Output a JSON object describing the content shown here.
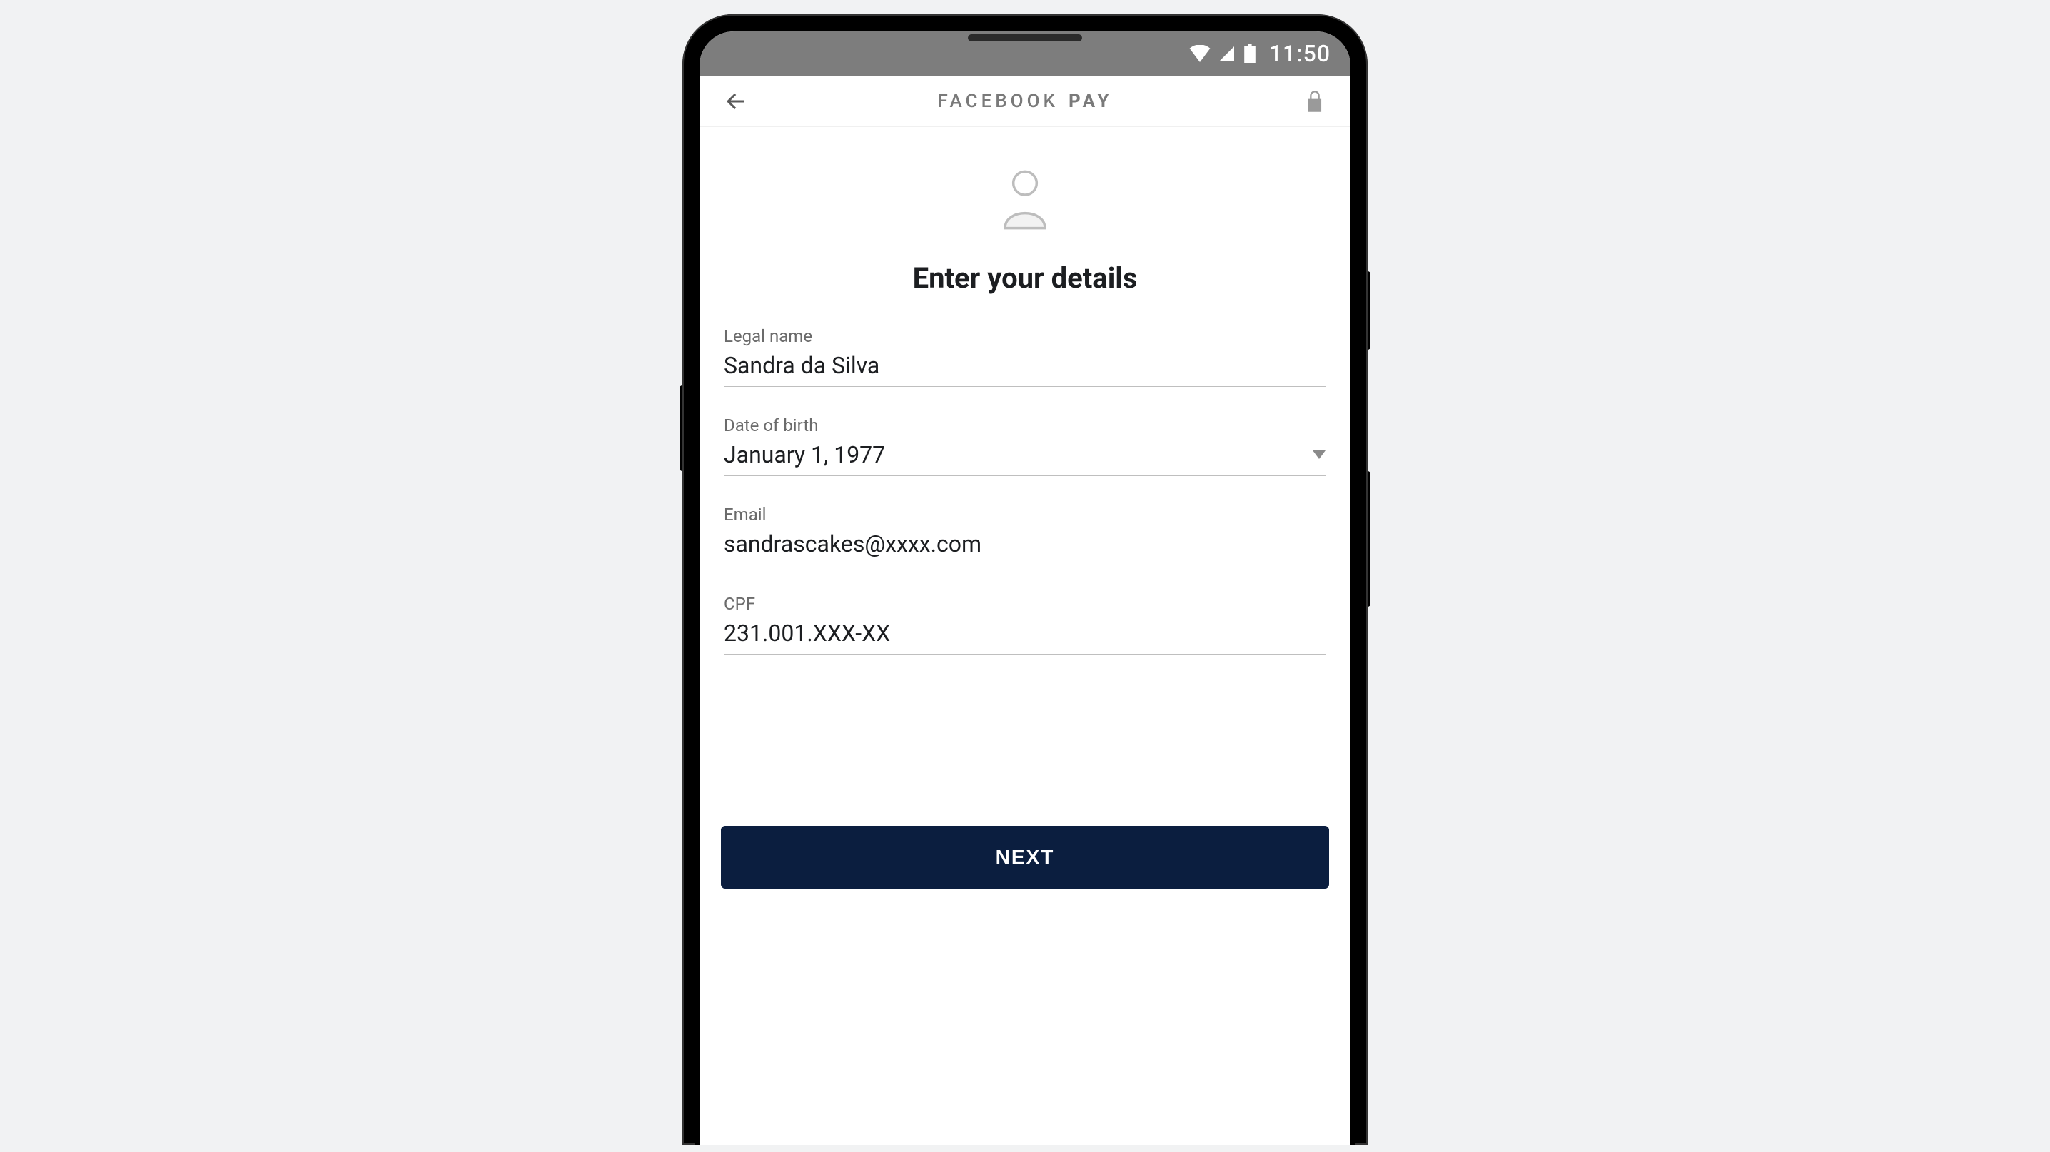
{
  "status": {
    "time": "11:50"
  },
  "header": {
    "brand_part1": "FACEBOOK",
    "brand_part2": "PAY"
  },
  "page": {
    "title": "Enter your details"
  },
  "form": {
    "legal_name": {
      "label": "Legal name",
      "value": "Sandra da Silva"
    },
    "dob": {
      "label": "Date of birth",
      "value": "January 1, 1977"
    },
    "email": {
      "label": "Email",
      "value": "sandrascakes@xxxx.com"
    },
    "cpf": {
      "label": "CPF",
      "value": "231.001.XXX-XX"
    }
  },
  "actions": {
    "next": "NEXT"
  },
  "colors": {
    "primary_button_bg": "#0b1e3f",
    "status_bar_bg": "#7d7d7d",
    "label_text": "#6b6b6b"
  }
}
